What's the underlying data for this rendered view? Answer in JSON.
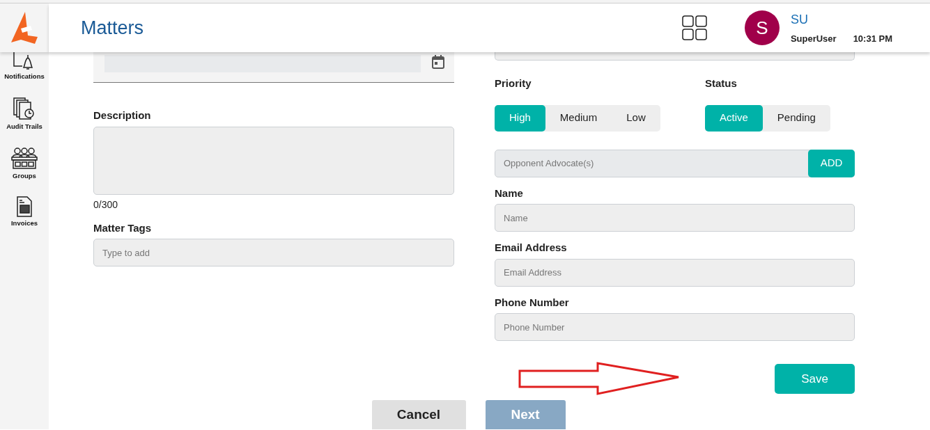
{
  "app": {
    "title": "Matters"
  },
  "sidebar": {
    "items": [
      {
        "label": "Notifications",
        "kind": "bell"
      },
      {
        "label": "Audit Trails",
        "kind": "audit"
      },
      {
        "label": "Groups",
        "kind": "groups"
      },
      {
        "label": "Invoices",
        "kind": "invoice"
      }
    ]
  },
  "user": {
    "avatar_letter": "S",
    "initials": "SU",
    "name": "SuperUser",
    "time": "10:31 PM"
  },
  "form_left": {
    "description": {
      "label": "Description",
      "counter": "0/300"
    },
    "matter_tags": {
      "label": "Matter Tags",
      "placeholder": "Type to add"
    }
  },
  "form_right": {
    "priority": {
      "label": "Priority",
      "options": [
        {
          "label": "High",
          "selected": true
        },
        {
          "label": "Medium",
          "selected": false
        },
        {
          "label": "Low",
          "selected": false
        }
      ]
    },
    "status": {
      "label": "Status",
      "options": [
        {
          "label": "Active",
          "selected": true
        },
        {
          "label": "Pending",
          "selected": false
        }
      ]
    },
    "opponent": {
      "placeholder": "Opponent Advocate(s)",
      "button": "ADD"
    },
    "fields": [
      {
        "label": "Name",
        "placeholder": "Name"
      },
      {
        "label": "Email Address",
        "placeholder": "Email Address"
      },
      {
        "label": "Phone Number",
        "placeholder": "Phone Number"
      }
    ],
    "save": "Save"
  },
  "footer": {
    "buttons": [
      {
        "label": "Cancel",
        "disabled": false
      },
      {
        "label": "Next",
        "disabled": true
      }
    ]
  }
}
